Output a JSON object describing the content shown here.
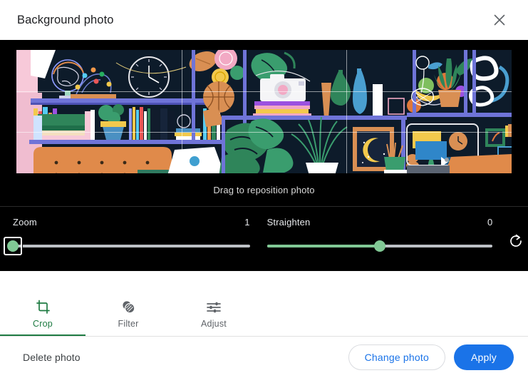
{
  "dialog": {
    "title": "Background photo",
    "close_icon": "close-icon"
  },
  "editor": {
    "drag_hint": "Drag to reposition photo",
    "crop_grid": {
      "visible": true,
      "lines": "rule-of-thirds"
    },
    "photo": {
      "alt": "Illustrated home-office scene with bookshelves, globe, wall clock, plants, desk computer and orange sofa",
      "background_color": "#0d1b2a"
    }
  },
  "controls": {
    "zoom": {
      "label": "Zoom",
      "value": "1",
      "fill_percent": 0,
      "focused": true,
      "accent_color": "#81c995",
      "track_color": "#bdc1c6"
    },
    "straighten": {
      "label": "Straighten",
      "value": "0",
      "fill_percent": 50,
      "focused": false,
      "accent_color": "#81c995",
      "track_color": "#bdc1c6"
    },
    "reset": {
      "icon": "rotate-reset-icon",
      "tooltip": "Reset"
    }
  },
  "tabs": {
    "active_index": 0,
    "accent_color": "#1e7b42",
    "items": [
      {
        "label": "Crop",
        "icon": "crop-icon"
      },
      {
        "label": "Filter",
        "icon": "filter-icon"
      },
      {
        "label": "Adjust",
        "icon": "adjust-sliders-icon"
      }
    ]
  },
  "footer": {
    "delete_label": "Delete photo",
    "change_label": "Change photo",
    "apply_label": "Apply",
    "primary_color": "#1a73e8"
  }
}
